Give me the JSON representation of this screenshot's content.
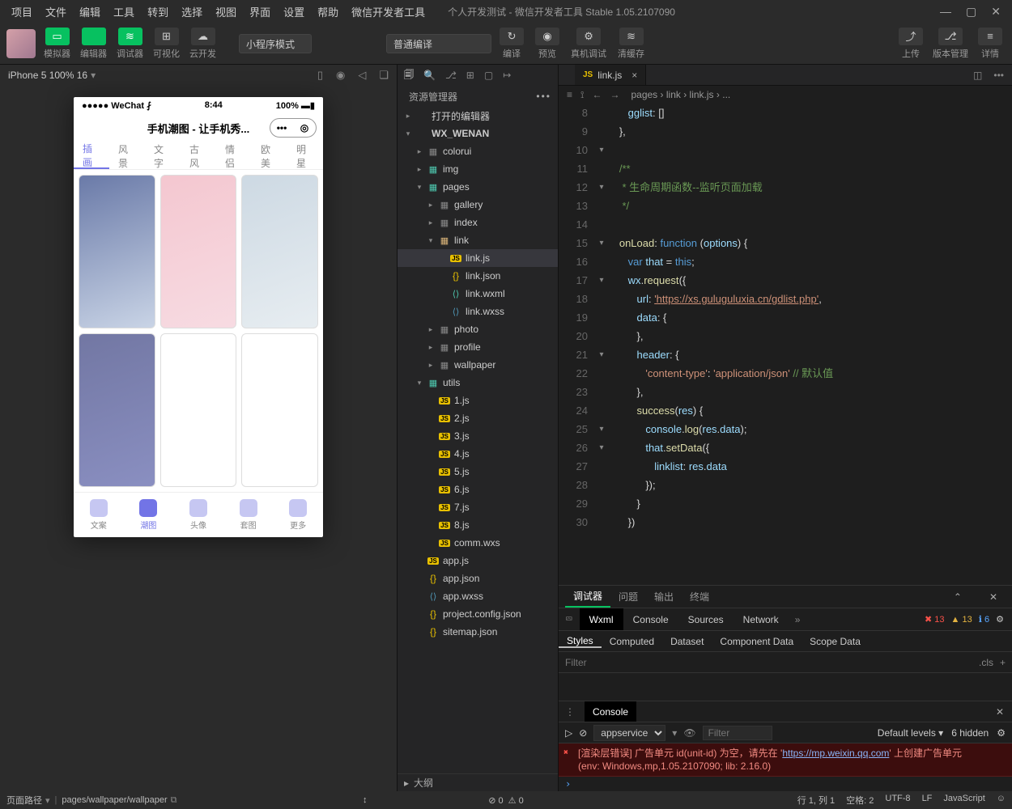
{
  "menu": [
    "项目",
    "文件",
    "编辑",
    "工具",
    "转到",
    "选择",
    "视图",
    "界面",
    "设置",
    "帮助",
    "微信开发者工具"
  ],
  "windowTitle": "个人开发测试 - 微信开发者工具 Stable 1.05.2107090",
  "toolbar": {
    "groups": [
      {
        "label": "模拟器",
        "cls": "green",
        "glyph": "▭"
      },
      {
        "label": "编辑器",
        "cls": "green",
        "glyph": "</>"
      },
      {
        "label": "调试器",
        "cls": "green",
        "glyph": "≋"
      },
      {
        "label": "可视化",
        "cls": "gray",
        "glyph": "⊞"
      },
      {
        "label": "云开发",
        "cls": "gray",
        "glyph": "☁"
      }
    ],
    "modeSelect": "小程序模式",
    "compileSelect": "普通编译",
    "compile": "编译",
    "preview": "预览",
    "realdbg": "真机调试",
    "clear": "清缓存",
    "upload": "上传",
    "version": "版本管理",
    "detail": "详情"
  },
  "sim": {
    "device": "iPhone 5 100% 16",
    "phone": {
      "carrier": "WeChat",
      "time": "8:44",
      "battery": "100%",
      "title": "手机潮图 - 让手机秀...",
      "tabs": [
        "插画",
        "风景",
        "文字",
        "古风",
        "情侣",
        "欧美",
        "明星"
      ],
      "tabbar": [
        {
          "l": "文案",
          "clr": "#c6c7f2"
        },
        {
          "l": "潮图",
          "clr": "#7274e6",
          "active": true
        },
        {
          "l": "头像",
          "clr": "#c6c7f2"
        },
        {
          "l": "套图",
          "clr": "#c6c7f2"
        },
        {
          "l": "更多",
          "clr": "#c6c7f2"
        }
      ],
      "thumbs": [
        "linear-gradient(160deg,#6a7aa8,#c9d4e6)",
        "linear-gradient(160deg,#f4c7d0,#f7dbe2)",
        "linear-gradient(160deg,#cdd9e3,#e7edf1)",
        "linear-gradient(160deg,#7277a3,#8a8fc1)",
        "#ffffff",
        "#ffffff"
      ]
    }
  },
  "filesTitle": "资源管理器",
  "tree": [
    {
      "d": 0,
      "arrow": "▸",
      "ico": "",
      "cls": "",
      "l": "打开的编辑器"
    },
    {
      "d": 0,
      "arrow": "▾",
      "ico": "",
      "cls": "",
      "l": "WX_WENAN",
      "bold": true
    },
    {
      "d": 1,
      "arrow": "▸",
      "ico": "▦",
      "cls": "folder-ico",
      "l": "colorui"
    },
    {
      "d": 1,
      "arrow": "▸",
      "ico": "▦",
      "cls": "folder-ico pages",
      "l": "img"
    },
    {
      "d": 1,
      "arrow": "▾",
      "ico": "▦",
      "cls": "folder-ico pages",
      "l": "pages"
    },
    {
      "d": 2,
      "arrow": "▸",
      "ico": "▦",
      "cls": "folder-ico",
      "l": "gallery"
    },
    {
      "d": 2,
      "arrow": "▸",
      "ico": "▦",
      "cls": "folder-ico",
      "l": "index"
    },
    {
      "d": 2,
      "arrow": "▾",
      "ico": "▦",
      "cls": "folder-ico open",
      "l": "link"
    },
    {
      "d": 3,
      "arrow": "",
      "ico": "JS",
      "cls": "file-ico-js",
      "l": "link.js",
      "sel": true
    },
    {
      "d": 3,
      "arrow": "",
      "ico": "{}",
      "cls": "file-ico-json",
      "l": "link.json"
    },
    {
      "d": 3,
      "arrow": "",
      "ico": "⟨⟩",
      "cls": "file-ico-wxml",
      "l": "link.wxml"
    },
    {
      "d": 3,
      "arrow": "",
      "ico": "⟨⟩",
      "cls": "file-ico-wxss",
      "l": "link.wxss"
    },
    {
      "d": 2,
      "arrow": "▸",
      "ico": "▦",
      "cls": "folder-ico",
      "l": "photo"
    },
    {
      "d": 2,
      "arrow": "▸",
      "ico": "▦",
      "cls": "folder-ico",
      "l": "profile"
    },
    {
      "d": 2,
      "arrow": "▸",
      "ico": "▦",
      "cls": "folder-ico",
      "l": "wallpaper"
    },
    {
      "d": 1,
      "arrow": "▾",
      "ico": "▦",
      "cls": "folder-ico utils",
      "l": "utils"
    },
    {
      "d": 2,
      "arrow": "",
      "ico": "JS",
      "cls": "file-ico-js",
      "l": "1.js"
    },
    {
      "d": 2,
      "arrow": "",
      "ico": "JS",
      "cls": "file-ico-js",
      "l": "2.js"
    },
    {
      "d": 2,
      "arrow": "",
      "ico": "JS",
      "cls": "file-ico-js",
      "l": "3.js"
    },
    {
      "d": 2,
      "arrow": "",
      "ico": "JS",
      "cls": "file-ico-js",
      "l": "4.js"
    },
    {
      "d": 2,
      "arrow": "",
      "ico": "JS",
      "cls": "file-ico-js",
      "l": "5.js"
    },
    {
      "d": 2,
      "arrow": "",
      "ico": "JS",
      "cls": "file-ico-js",
      "l": "6.js"
    },
    {
      "d": 2,
      "arrow": "",
      "ico": "JS",
      "cls": "file-ico-js",
      "l": "7.js"
    },
    {
      "d": 2,
      "arrow": "",
      "ico": "JS",
      "cls": "file-ico-js",
      "l": "8.js"
    },
    {
      "d": 2,
      "arrow": "",
      "ico": "JS",
      "cls": "file-ico-js",
      "l": "comm.wxs"
    },
    {
      "d": 1,
      "arrow": "",
      "ico": "JS",
      "cls": "file-ico-js",
      "l": "app.js"
    },
    {
      "d": 1,
      "arrow": "",
      "ico": "{}",
      "cls": "file-ico-json",
      "l": "app.json"
    },
    {
      "d": 1,
      "arrow": "",
      "ico": "⟨⟩",
      "cls": "file-ico-wxss",
      "l": "app.wxss"
    },
    {
      "d": 1,
      "arrow": "",
      "ico": "{}",
      "cls": "file-ico-json",
      "l": "project.config.json"
    },
    {
      "d": 1,
      "arrow": "",
      "ico": "{}",
      "cls": "file-ico-json",
      "l": "sitemap.json"
    }
  ],
  "outline": "大纲",
  "editor": {
    "tabLabel": "link.js",
    "breadcrumb": [
      "pages",
      "link",
      "link.js",
      "..."
    ],
    "startLine": 8,
    "folds": {
      "10": "▾",
      "12": "▾",
      "15": "▾",
      "17": "▾",
      "21": "▾",
      "25": "▾",
      "26": "▾"
    },
    "lines": [
      "      <span class='c-prop'>gglist</span><span class='c-pun'>: []</span>",
      "   <span class='c-pun'>},</span>",
      "",
      "   <span class='c-cm'>/**</span>",
      "   <span class='c-cm'> * 生命周期函数--监听页面加载</span>",
      "   <span class='c-cm'> */</span>",
      "",
      "   <span class='c-fn'>onLoad</span><span class='c-pun'>: </span><span class='c-kw'>function</span> <span class='c-pun'>(</span><span class='c-var'>options</span><span class='c-pun'>) {</span>",
      "      <span class='c-kw'>var</span> <span class='c-var'>that</span> <span class='c-pun'>=</span> <span class='c-this'>this</span><span class='c-pun'>;</span>",
      "      <span class='c-var'>wx</span><span class='c-pun'>.</span><span class='c-fn'>request</span><span class='c-pun'>({</span>",
      "         <span class='c-prop'>url</span><span class='c-pun'>: </span><span class='c-strlink'>'https://xs.guluguluxia.cn/gdlist.php'</span><span class='c-pun'>,</span>",
      "         <span class='c-prop'>data</span><span class='c-pun'>: {</span>",
      "         <span class='c-pun'>},</span>",
      "         <span class='c-prop'>header</span><span class='c-pun'>: {</span>",
      "            <span class='c-str'>'content-type'</span><span class='c-pun'>: </span><span class='c-str'>'application/json'</span> <span class='c-cm'>// 默认值</span>",
      "         <span class='c-pun'>},</span>",
      "         <span class='c-fn'>success</span><span class='c-pun'>(</span><span class='c-var'>res</span><span class='c-pun'>) {</span>",
      "            <span class='c-var'>console</span><span class='c-pun'>.</span><span class='c-fn'>log</span><span class='c-pun'>(</span><span class='c-var'>res</span><span class='c-pun'>.</span><span class='c-var'>data</span><span class='c-pun'>);</span>",
      "            <span class='c-var'>that</span><span class='c-pun'>.</span><span class='c-fn'>setData</span><span class='c-pun'>({</span>",
      "               <span class='c-prop'>linklist</span><span class='c-pun'>: </span><span class='c-var'>res</span><span class='c-pun'>.</span><span class='c-var'>data</span>",
      "            <span class='c-pun'>});</span>",
      "         <span class='c-pun'>}</span>",
      "      <span class='c-pun'>})</span>"
    ]
  },
  "dbg": {
    "tabs1": [
      "调试器",
      "问题",
      "输出",
      "终端"
    ],
    "tabs2": [
      "Wxml",
      "Console",
      "Sources",
      "Network"
    ],
    "counts": {
      "err": "13",
      "warn": "13",
      "info": "6"
    },
    "subTabs": [
      "Styles",
      "Computed",
      "Dataset",
      "Component Data",
      "Scope Data"
    ],
    "filter": "Filter",
    "cls": ".cls"
  },
  "console": {
    "title": "Console",
    "scope": "appservice",
    "defaultLevels": "Default levels",
    "filter": "Filter",
    "hidden": "6 hidden",
    "errLine1": "[渲染层错误] 广告单元 id(unit-id) 为空，请先在 '",
    "errLink": "https://mp.weixin.qq.com",
    "errLine1b": "' 上创建广告单元",
    "errLine2": "(env: Windows,mp,1.05.2107090; lib: 2.16.0)"
  },
  "status": {
    "routeLabel": "页面路径",
    "route": "pages/wallpaper/wallpaper",
    "problems": "0",
    "warn": "0",
    "line": "行 1, 列 1",
    "spaces": "空格: 2",
    "enc": "UTF-8",
    "eol": "LF",
    "lang": "JavaScript"
  }
}
